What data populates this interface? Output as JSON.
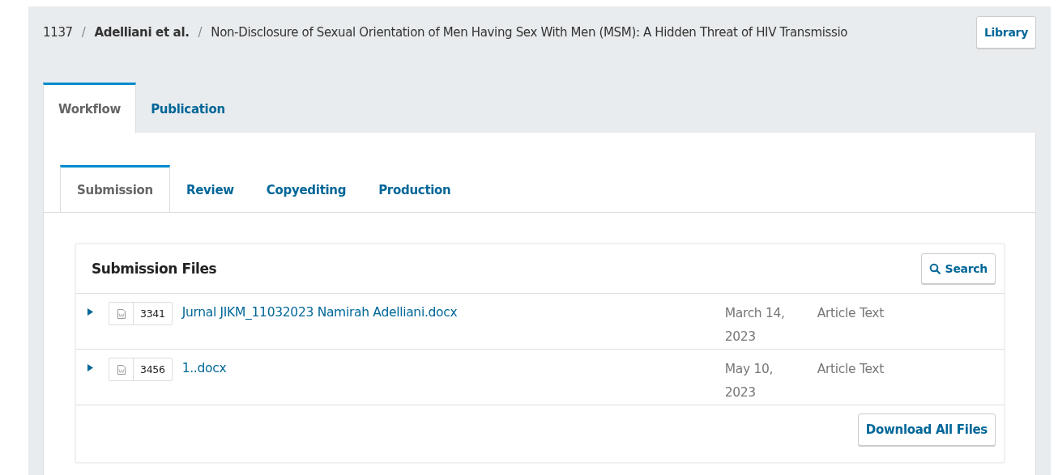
{
  "breadcrumb": {
    "id": "1137",
    "separators": [
      "/",
      "/"
    ],
    "authors": "Adelliani et al.",
    "title": "Non-Disclosure of Sexual Orientation of Men Having Sex With Men (MSM): A Hidden Threat of HIV Transmissio"
  },
  "library_button": "Library",
  "tabs": [
    {
      "label": "Workflow",
      "selected": true
    },
    {
      "label": "Publication",
      "selected": false
    }
  ],
  "stage_tabs": [
    {
      "label": "Submission",
      "selected": true
    },
    {
      "label": "Review",
      "selected": false
    },
    {
      "label": "Copyediting",
      "selected": false
    },
    {
      "label": "Production",
      "selected": false
    }
  ],
  "files_panel": {
    "title": "Submission Files",
    "search_button": "Search",
    "download_button": "Download All Files",
    "rows": [
      {
        "id": "3341",
        "name": "Jurnal JIKM_11032023 Namirah Adelliani.docx",
        "date": "March 14, 2023",
        "type": "Article Text"
      },
      {
        "id": "3456",
        "name": "1..docx",
        "date": "May 10, 2023",
        "type": "Article Text"
      }
    ]
  }
}
